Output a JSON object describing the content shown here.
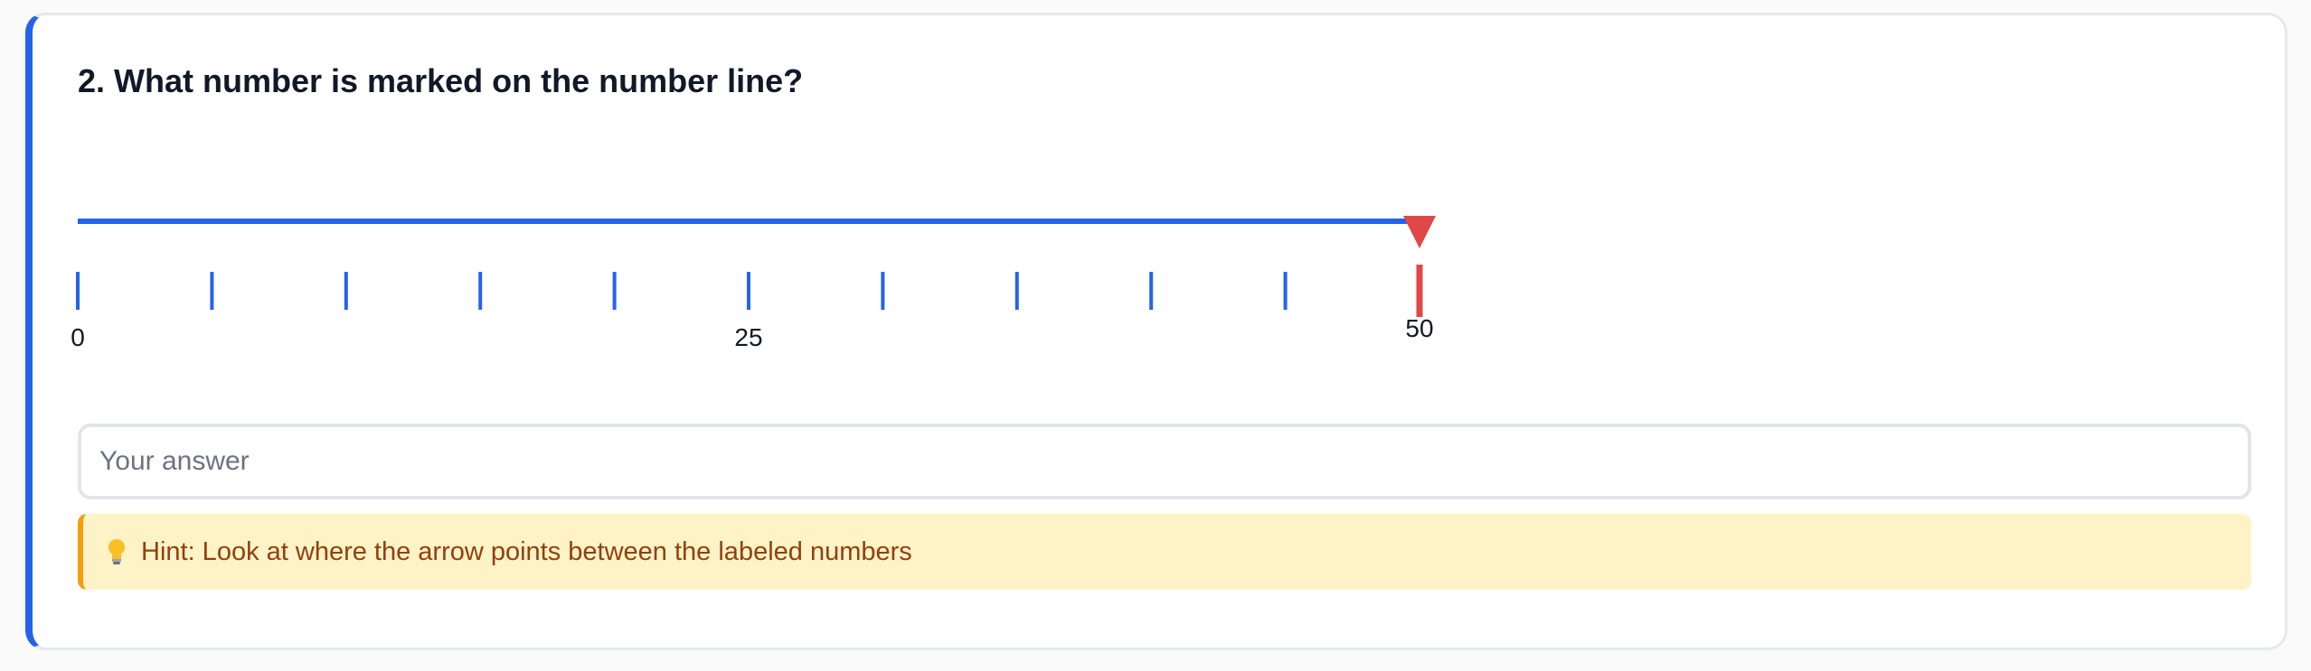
{
  "question": {
    "title": "2. What number is marked on the number line?"
  },
  "number_line": {
    "min": 0,
    "max": 50,
    "tick_count": 11,
    "labels": [
      {
        "value": 0,
        "text": "0"
      },
      {
        "value": 25,
        "text": "25"
      },
      {
        "value": 50,
        "text": "50"
      }
    ],
    "marked_value": 50,
    "colors": {
      "line": "#2563eb",
      "marker": "#e04747"
    }
  },
  "answer": {
    "value": "",
    "placeholder": "Your answer"
  },
  "hint": {
    "icon": "lightbulb-icon",
    "text": "Hint: Look at where the arrow points between the labeled numbers"
  }
}
